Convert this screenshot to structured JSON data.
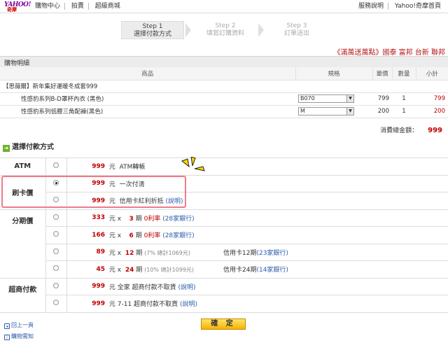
{
  "header": {
    "logo_text": "YAHOO!",
    "logo_sub": "奇摩",
    "nav_left": [
      "購物中心",
      "拍賣",
      "超級商城"
    ],
    "nav_right": [
      "服務說明",
      "Yahoo!奇摩首頁"
    ]
  },
  "steps": [
    {
      "n": "Step 1",
      "label": "選擇付款方式"
    },
    {
      "n": "Step 2",
      "label": "填寫訂購資料"
    },
    {
      "n": "Step 3",
      "label": "訂單送出"
    }
  ],
  "promo": "《滿萬送萬點》國泰 富邦 台新 聯邦",
  "cart": {
    "title": "購物明細",
    "headers": [
      "商品",
      "規格",
      "單價",
      "數量",
      "小計"
    ],
    "store": "【思薇爾】新年集好運暖冬成套999",
    "items": [
      {
        "name": "性感豹系列B-D罩杯內衣 (黑色)",
        "spec": "B070",
        "price": "799",
        "qty": "1",
        "subtotal": "799"
      },
      {
        "name": "性感豹系列低腰三角配褲(黑色)",
        "spec": "M",
        "price": "200",
        "qty": "1",
        "subtotal": "200"
      }
    ],
    "total_label": "消費總金額：",
    "total": "999"
  },
  "payment": {
    "title": "選擇付款方式",
    "yuan": "元",
    "categories": {
      "atm": "ATM",
      "card": "刷卡價",
      "install": "分期價",
      "store": "超商付款"
    },
    "atm": {
      "amount": "999",
      "desc": "ATM轉帳"
    },
    "card": [
      {
        "amount": "999",
        "desc": "一次付清"
      },
      {
        "amount": "999",
        "desc": "信用卡紅利折抵",
        "link": "(說明)"
      }
    ],
    "install": [
      {
        "amount": "333",
        "x": "x",
        "months": "3",
        "unit": "期",
        "rate": "0利率",
        "banks": "(28家銀行)"
      },
      {
        "amount": "166",
        "x": "x",
        "months": "6",
        "unit": "期",
        "rate": "0利率",
        "banks": "(28家銀行)"
      },
      {
        "amount": "89",
        "x": "x",
        "months": "12",
        "unit": "期",
        "note": "(7% 總計1069元)",
        "card": "信用卡12期",
        "card_banks": "(23家銀行)"
      },
      {
        "amount": "45",
        "x": "x",
        "months": "24",
        "unit": "期",
        "note": "(10% 總計1099元)",
        "card": "信用卡24期",
        "card_banks": "(14家銀行)"
      }
    ],
    "store": [
      {
        "amount": "999",
        "desc": "全家 超商付款不取貨",
        "link": "(說明)"
      },
      {
        "amount": "999",
        "desc": "7-11 超商付款不取貨",
        "link": "(說明)"
      }
    ]
  },
  "footer": {
    "back": "回上一頁",
    "help": "購物需知",
    "confirm": "確 定"
  }
}
